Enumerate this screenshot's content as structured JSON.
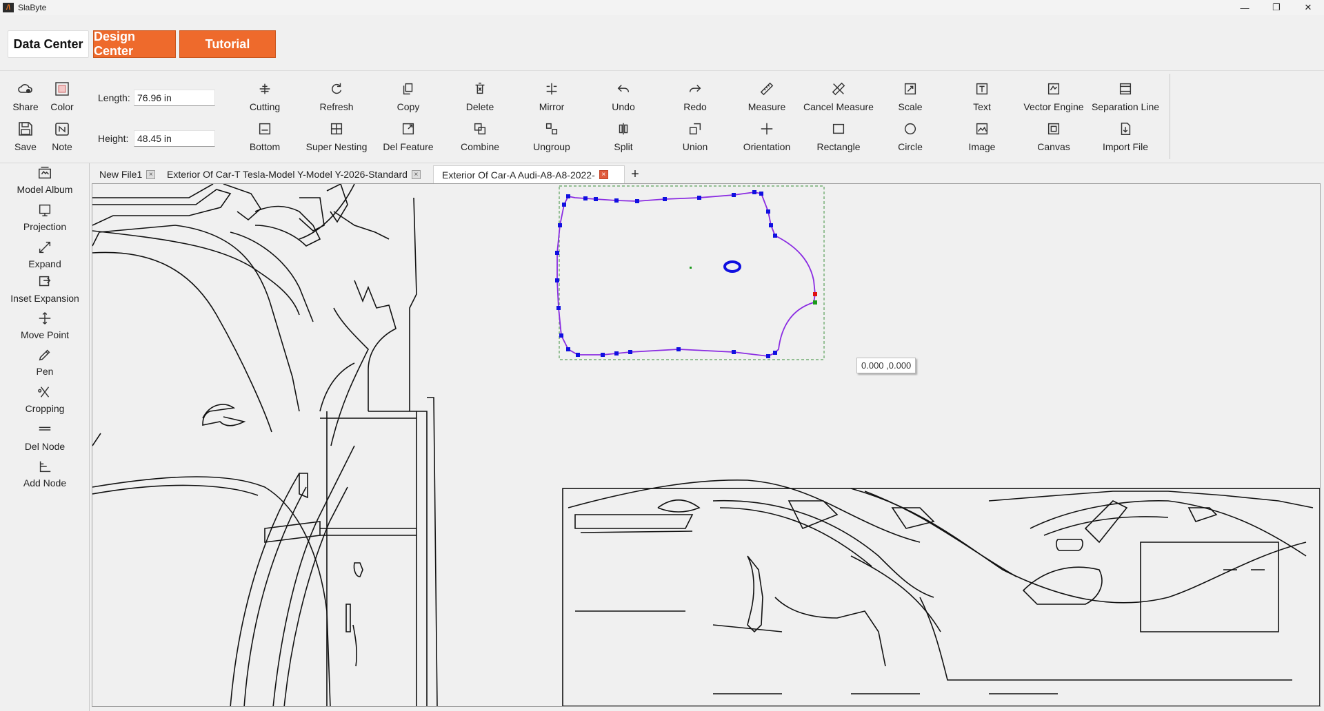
{
  "app": {
    "title": "SlaByte",
    "logo_text": "/\\"
  },
  "window_controls": {
    "minimize": "—",
    "maximize": "❐",
    "close": "✕"
  },
  "nav": {
    "data_center": "Data Center",
    "design_center": "Design Center",
    "tutorial": "Tutorial"
  },
  "toolbar": {
    "share": "Share",
    "color": "Color",
    "save": "Save",
    "note": "Note",
    "length_label": "Length:",
    "length_value": "76.96 in",
    "height_label": "Height:",
    "height_value": "48.45 in",
    "row1": [
      "Cutting",
      "Refresh",
      "Copy",
      "Delete",
      "Mirror",
      "Undo",
      "Redo",
      "Measure",
      "Cancel Measure",
      "Scale",
      "Text",
      "Vector Engine",
      "Separation Line"
    ],
    "row2": [
      "Bottom",
      "Super Nesting",
      "Del Feature",
      "Combine",
      "Ungroup",
      "Split",
      "Union",
      "Orientation",
      "Rectangle",
      "Circle",
      "Image",
      "Canvas",
      "Import File"
    ]
  },
  "sidebar": [
    "Model Album",
    "Projection",
    "Expand",
    "Inset Expansion",
    "Move Point",
    "Pen",
    "Cropping",
    "Del Node",
    "Add Node"
  ],
  "tabs": [
    {
      "label": "New File1"
    },
    {
      "label": "Exterior Of Car-T Tesla-Model Y-Model Y-2026-Standard"
    },
    {
      "label": "Exterior Of Car-A Audi-A8-A8-2022-"
    }
  ],
  "tab_add": "+",
  "canvas": {
    "coordinate_readout": "0.000 ,0.000"
  },
  "colors": {
    "accent": "#ee6a2c",
    "selection_nodes": "#1010e0",
    "selection_path": "#8a2be2",
    "bounding_box": "#5aa05a"
  }
}
